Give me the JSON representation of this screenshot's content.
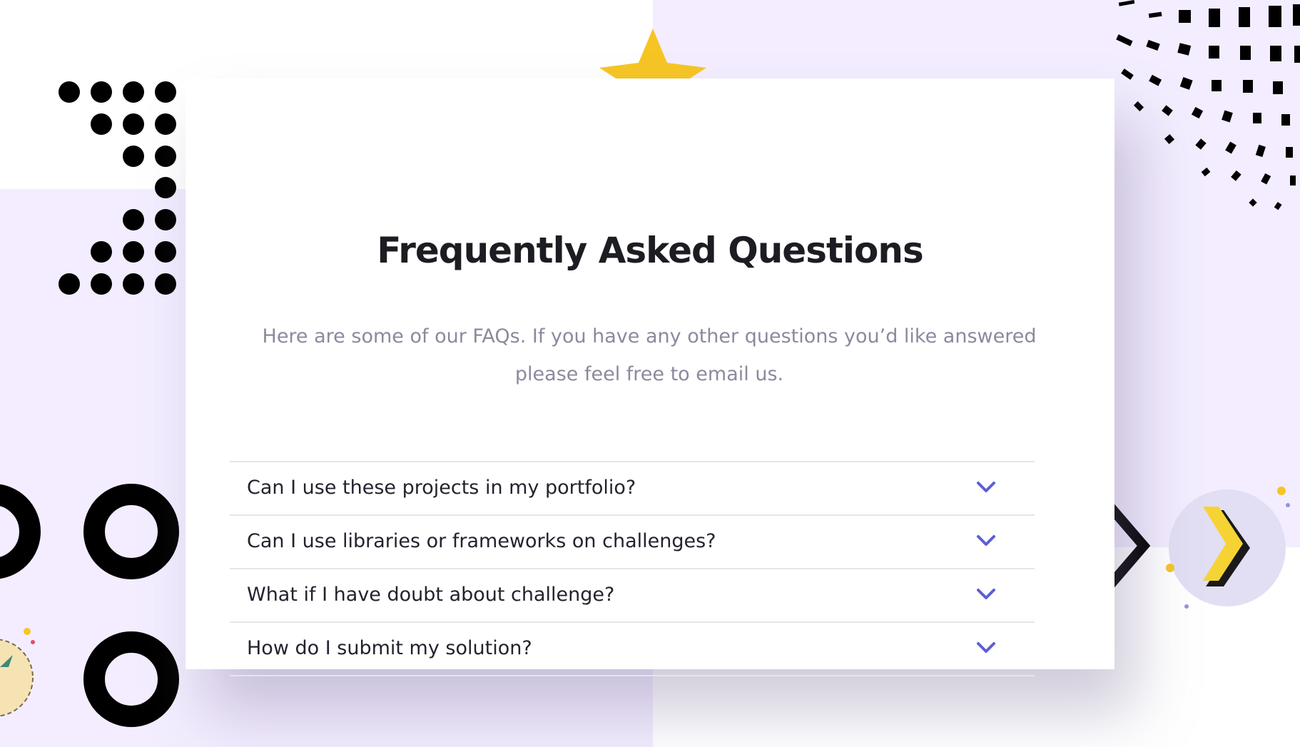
{
  "faq": {
    "title": "Frequently Asked Questions",
    "subtitle_line1": "Here are some of our FAQs. If you have any other questions you’d like answered",
    "subtitle_line2": "please feel free to email us.",
    "items": [
      {
        "question": "Can I use these projects in my portfolio?",
        "icon": "chevron-down-icon"
      },
      {
        "question": "Can I use libraries or frameworks on challenges?",
        "icon": "chevron-down-icon"
      },
      {
        "question": "What if I have doubt about challenge?",
        "icon": "chevron-down-icon"
      },
      {
        "question": "How do I submit my solution?",
        "icon": "chevron-down-icon"
      }
    ]
  },
  "colors": {
    "accent": "#5b5fd6",
    "background_lilac": "#f3edff",
    "title": "#1c1d23",
    "subtitle": "#8a8a9e",
    "decor_yellow": "#f6c524"
  },
  "decor": {
    "icons": [
      "dot-grid-icon",
      "star-icon",
      "halftone-icon",
      "ring-icon",
      "arrow-button-icon",
      "diamond-icon",
      "badge-icon"
    ]
  }
}
